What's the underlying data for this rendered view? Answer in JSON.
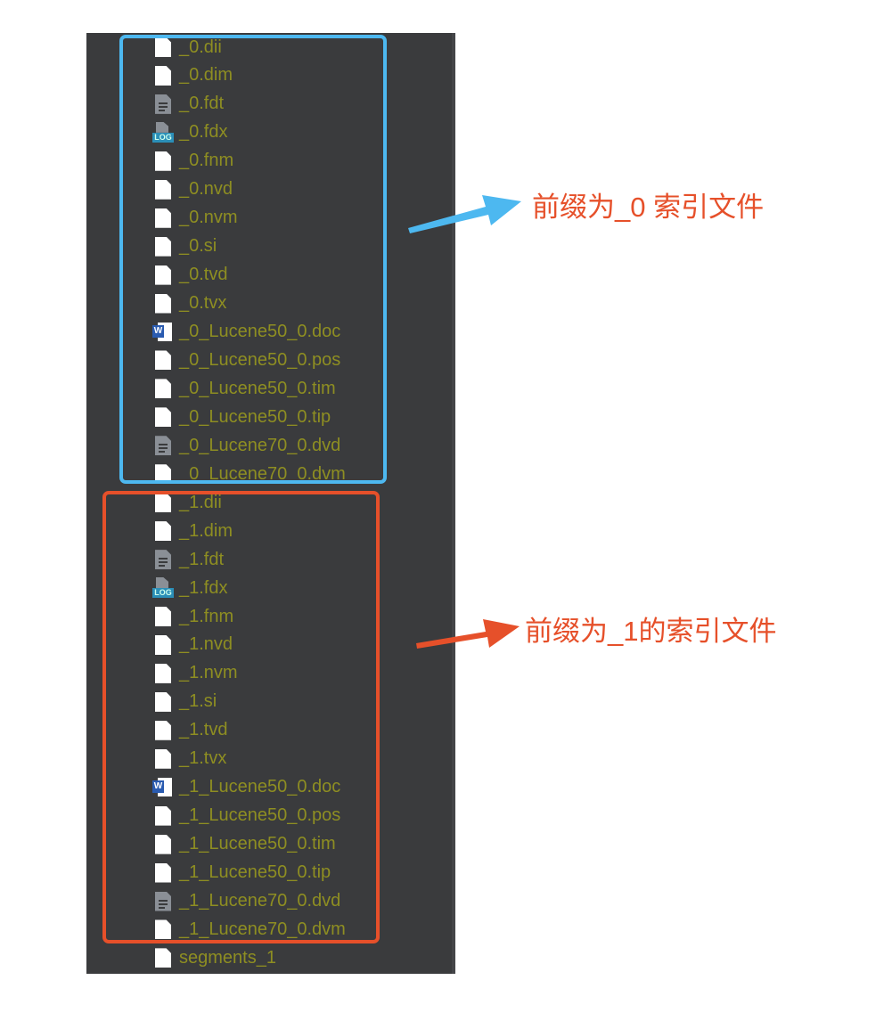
{
  "files": [
    {
      "name": "_0.dii",
      "icon": "blank-file-icon"
    },
    {
      "name": "_0.dim",
      "icon": "blank-file-icon"
    },
    {
      "name": "_0.fdt",
      "icon": "text-file-icon"
    },
    {
      "name": "_0.fdx",
      "icon": "log-file-icon"
    },
    {
      "name": "_0.fnm",
      "icon": "blank-file-icon"
    },
    {
      "name": "_0.nvd",
      "icon": "blank-file-icon"
    },
    {
      "name": "_0.nvm",
      "icon": "blank-file-icon"
    },
    {
      "name": "_0.si",
      "icon": "blank-file-icon"
    },
    {
      "name": "_0.tvd",
      "icon": "blank-file-icon"
    },
    {
      "name": "_0.tvx",
      "icon": "blank-file-icon"
    },
    {
      "name": "_0_Lucene50_0.doc",
      "icon": "word-file-icon"
    },
    {
      "name": "_0_Lucene50_0.pos",
      "icon": "blank-file-icon"
    },
    {
      "name": "_0_Lucene50_0.tim",
      "icon": "blank-file-icon"
    },
    {
      "name": "_0_Lucene50_0.tip",
      "icon": "blank-file-icon"
    },
    {
      "name": "_0_Lucene70_0.dvd",
      "icon": "text-file-icon"
    },
    {
      "name": "_0_Lucene70_0.dvm",
      "icon": "blank-file-icon"
    },
    {
      "name": "_1.dii",
      "icon": "blank-file-icon"
    },
    {
      "name": "_1.dim",
      "icon": "blank-file-icon"
    },
    {
      "name": "_1.fdt",
      "icon": "text-file-icon"
    },
    {
      "name": "_1.fdx",
      "icon": "log-file-icon"
    },
    {
      "name": "_1.fnm",
      "icon": "blank-file-icon"
    },
    {
      "name": "_1.nvd",
      "icon": "blank-file-icon"
    },
    {
      "name": "_1.nvm",
      "icon": "blank-file-icon"
    },
    {
      "name": "_1.si",
      "icon": "blank-file-icon"
    },
    {
      "name": "_1.tvd",
      "icon": "blank-file-icon"
    },
    {
      "name": "_1.tvx",
      "icon": "blank-file-icon"
    },
    {
      "name": "_1_Lucene50_0.doc",
      "icon": "word-file-icon"
    },
    {
      "name": "_1_Lucene50_0.pos",
      "icon": "blank-file-icon"
    },
    {
      "name": "_1_Lucene50_0.tim",
      "icon": "blank-file-icon"
    },
    {
      "name": "_1_Lucene50_0.tip",
      "icon": "blank-file-icon"
    },
    {
      "name": "_1_Lucene70_0.dvd",
      "icon": "text-file-icon"
    },
    {
      "name": "_1_Lucene70_0.dvm",
      "icon": "blank-file-icon"
    },
    {
      "name": "segments_1",
      "icon": "blank-file-icon"
    }
  ],
  "annotations": {
    "group0": {
      "label": "前缀为_0 索引文件",
      "color": "#4db8f0"
    },
    "group1": {
      "label": "前缀为_1的索引文件",
      "color": "#e6502a"
    }
  },
  "colors": {
    "panel_bg": "#3a3b3d",
    "file_name": "#8e8e22",
    "note_text": "#e6502a"
  }
}
